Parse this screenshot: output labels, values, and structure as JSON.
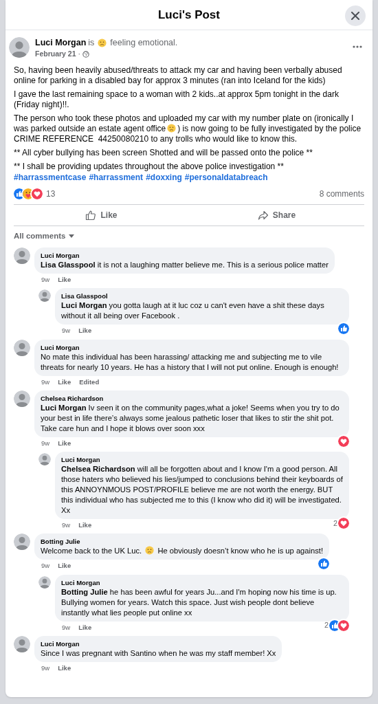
{
  "dialog": {
    "title": "Luci's Post"
  },
  "post": {
    "author": "Luci Morgan",
    "feeling_prefix": "is",
    "feeling": "feeling emotional.",
    "date": "February 21",
    "date_separator": "·",
    "paragraphs": [
      {
        "parts": [
          {
            "kind": "text",
            "text": "So, having been heavily abused/threats to attack my car and having been verbally abused online for parking in a disabled bay for approx 3 minutes (ran into Iceland for the kids)"
          }
        ]
      },
      {
        "parts": [
          {
            "kind": "text",
            "text": "I gave the last remaining space to a woman with 2 kids..at approx 5pm tonight in the dark (Friday night)!!."
          }
        ]
      },
      {
        "parts": [
          {
            "kind": "text",
            "text": "The person who took these photos and uploaded my car with my number plate on (ironically I was parked outside an estate agent office"
          },
          {
            "kind": "emoji"
          },
          {
            "kind": "text",
            "text": ") is now going to be fully investigated by the police CRIME REFERENCE  44250080210 to any trolls who would like to know this."
          }
        ]
      },
      {
        "parts": [
          {
            "kind": "text",
            "text": "** All cyber bullying has been screen Shotted and will be passed onto the police **"
          }
        ]
      },
      {
        "parts": [
          {
            "kind": "text",
            "text": "** I shall be providing updates throughout the above police investigation **"
          }
        ]
      }
    ],
    "hashtags": [
      "#harrassmentcase",
      "#harrassment",
      "#doxxing",
      "#personaldatabreach"
    ],
    "reactions": [
      {
        "kind": "like"
      },
      {
        "kind": "care"
      },
      {
        "kind": "love"
      }
    ],
    "reaction_count": "13",
    "comment_count": "8 comments",
    "actions": [
      {
        "kind": "like",
        "label": "Like"
      },
      {
        "kind": "share",
        "label": "Share"
      }
    ]
  },
  "comments_filter": "All comments",
  "comments": [
    {
      "author": "Luci Morgan",
      "mention": "Lisa Glasspool",
      "parts": [
        {
          "kind": "text",
          "text": " it is not a laughing matter believe me. This is a serious police matter"
        }
      ],
      "actions": [
        "9w",
        "Like"
      ],
      "replies": [
        {
          "author": "Lisa Glasspool",
          "mention": "Luci Morgan",
          "parts": [
            {
              "kind": "text",
              "text": " you gotta laugh at it luc coz u can't even have a shit these days without it all being over Facebook ."
            }
          ],
          "actions": [
            "9w",
            "Like"
          ],
          "reactions": [
            {
              "kind": "like"
            }
          ]
        }
      ]
    },
    {
      "author": "Luci Morgan",
      "parts": [
        {
          "kind": "text",
          "text": "No mate this individual has been harassing/ attacking me and subjecting me to vile threats for nearly 10 years. He has a history that I will not put online. Enough is enough!"
        }
      ],
      "actions": [
        "9w",
        "Like",
        "Edited"
      ]
    },
    {
      "author": "Chelsea Richardson",
      "mention": "Luci Morgan",
      "parts": [
        {
          "kind": "text",
          "text": " Iv seen it on the community pages,what a joke! Seems when you try to do your best in life there’s always some jealous pathetic loser that likes to stir the shit pot. Take care hun and I hope it blows over soon xxx"
        }
      ],
      "actions": [
        "9w",
        "Like"
      ],
      "reactions": [
        {
          "kind": "love"
        }
      ],
      "replies": [
        {
          "author": "Luci Morgan",
          "mention": "Chelsea Richardson",
          "parts": [
            {
              "kind": "text",
              "text": " will all be forgotten about and I know I'm a good person. All those haters who believed his lies/jumped to conclusions behind their keyboards of this ANNOYNMOUS POST/PROFILE believe me are not worth the energy. BUT this individual who has subjected me to this (I know who did it) will be investigated. Xx"
            }
          ],
          "actions": [
            "9w",
            "Like"
          ],
          "reaction_count": "2",
          "reactions": [
            {
              "kind": "love"
            }
          ]
        }
      ]
    },
    {
      "author": "Botting Julie",
      "parts": [
        {
          "kind": "text",
          "text": "Welcome back to the UK Luc. "
        },
        {
          "kind": "emoji"
        },
        {
          "kind": "text",
          "text": " He obviously doesn’t know who he is up against!"
        }
      ],
      "actions": [
        "9w",
        "Like"
      ],
      "reactions": [
        {
          "kind": "like"
        }
      ],
      "replies": [
        {
          "author": "Luci Morgan",
          "mention": "Botting Julie",
          "parts": [
            {
              "kind": "text",
              "text": " he has been awful for years Ju...and I'm hoping now his time is up. Bullying women for years. Watch this space. Just wish people dont believe instantly what lies people put online xx"
            }
          ],
          "actions": [
            "9w",
            "Like"
          ],
          "reaction_count": "2",
          "reactions": [
            {
              "kind": "like"
            },
            {
              "kind": "love"
            }
          ]
        }
      ]
    },
    {
      "author": "Luci Morgan",
      "parts": [
        {
          "kind": "text",
          "text": "Since I was pregnant with Santino when he was my staff member! Xx"
        }
      ],
      "actions": [
        "9w",
        "Like"
      ]
    }
  ]
}
